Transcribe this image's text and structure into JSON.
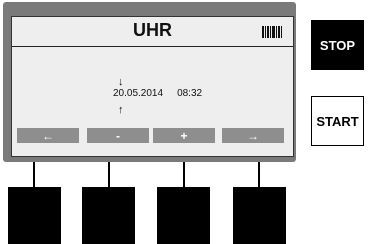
{
  "screen": {
    "title": "UHR",
    "barcode_icon": "barcode-icon",
    "cursor_up": "↓",
    "cursor_down": "↑",
    "date": "20.05.2014",
    "time": "08:32"
  },
  "softkeys": [
    {
      "label": "←"
    },
    {
      "label": "-"
    },
    {
      "label": "+"
    },
    {
      "label": "→"
    }
  ],
  "buttons": {
    "stop_label": "STOP",
    "start_label": "START"
  },
  "colors": {
    "frame": "#7a7a7a",
    "screen_bg": "#eeeeee",
    "softkey_bg": "#8e8e8e",
    "stop_bg": "#000000"
  }
}
